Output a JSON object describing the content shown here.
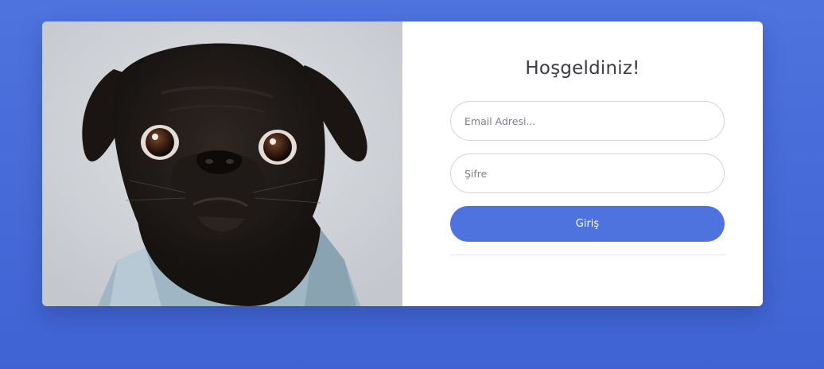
{
  "login": {
    "title": "Hoşgeldiniz!",
    "email_placeholder": "Email Adresi...",
    "password_placeholder": "Şifre",
    "submit_label": "Giriş"
  },
  "photo": {
    "subject": "pug-dog-photo"
  },
  "colors": {
    "background": "#4e73df",
    "button": "#4e73df",
    "card": "#ffffff",
    "title_text": "#3a3b45"
  }
}
